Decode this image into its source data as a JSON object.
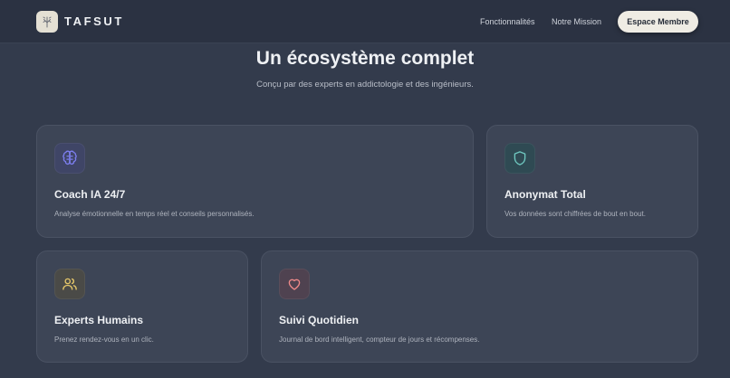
{
  "nav": {
    "brand": "TAFSUT",
    "links": [
      "Fonctionnalités",
      "Notre Mission"
    ],
    "cta": "Espace Membre"
  },
  "hero": {
    "title": "Un écosystème complet",
    "subtitle": "Conçu par des experts en addictologie et des ingénieurs."
  },
  "features": [
    {
      "icon": "brain-icon",
      "title": "Coach IA 24/7",
      "desc": "Analyse émotionnelle en temps réel et conseils personnalisés."
    },
    {
      "icon": "shield-icon",
      "title": "Anonymat Total",
      "desc": "Vos données sont chiffrées de bout en bout."
    },
    {
      "icon": "users-icon",
      "title": "Experts Humains",
      "desc": "Prenez rendez-vous en un clic."
    },
    {
      "icon": "heart-icon",
      "title": "Suivi Quotidien",
      "desc": "Journal de bord intelligent, compteur de jours et récompenses."
    }
  ],
  "colors": {
    "background": "#333b4c",
    "navbar": "#2b3242",
    "card": "#3d4556",
    "cta_bg": "#efece4",
    "brain": "#7d7ff0",
    "shield": "#6fc8c0",
    "users": "#e6c76a",
    "heart": "#ef8a8a"
  }
}
